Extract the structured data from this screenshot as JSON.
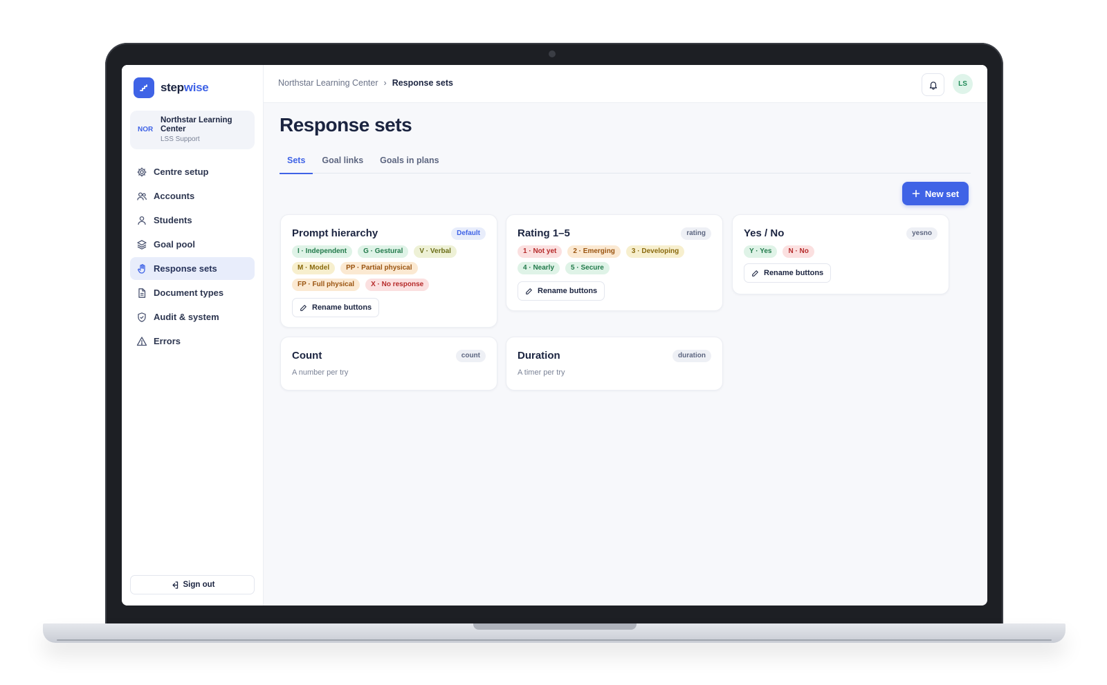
{
  "brand": {
    "name_prefix": "step",
    "name_suffix": "wise"
  },
  "org": {
    "abbr": "NOR",
    "name": "Northstar Learning Center",
    "sub": "LSS Support"
  },
  "nav": [
    {
      "label": "Centre setup",
      "icon": "gear-icon"
    },
    {
      "label": "Accounts",
      "icon": "users-icon"
    },
    {
      "label": "Students",
      "icon": "user-icon"
    },
    {
      "label": "Goal pool",
      "icon": "layers-icon"
    },
    {
      "label": "Response sets",
      "icon": "hand-icon",
      "active": true
    },
    {
      "label": "Document types",
      "icon": "document-icon"
    },
    {
      "label": "Audit & system",
      "icon": "shield-icon"
    },
    {
      "label": "Errors",
      "icon": "warning-icon"
    }
  ],
  "signout": {
    "label": "Sign out"
  },
  "topbar": {
    "breadcrumb": [
      "Northstar Learning Center",
      "Response sets"
    ],
    "separator": "›",
    "avatar": "LS"
  },
  "page": {
    "title": "Response sets",
    "tabs": [
      "Sets",
      "Goal links",
      "Goals in plans"
    ],
    "new_set": "New set"
  },
  "cards": {
    "prompt": {
      "title": "Prompt hierarchy",
      "badge": "Default",
      "chips": [
        "I · Independent",
        "G · Gestural",
        "V · Verbal",
        "M · Model",
        "PP · Partial physical",
        "FP · Full physical",
        "X · No response"
      ],
      "action": "Rename buttons"
    },
    "rating": {
      "title": "Rating 1–5",
      "badge": "rating",
      "chips": [
        "1 · Not yet",
        "2 · Emerging",
        "3 · Developing",
        "4 · Nearly",
        "5 · Secure"
      ],
      "action": "Rename buttons"
    },
    "yesno": {
      "title": "Yes / No",
      "badge": "yesno",
      "chips": [
        "Y · Yes",
        "N · No"
      ],
      "action": "Rename buttons"
    },
    "count": {
      "title": "Count",
      "badge": "count",
      "description": "A number per try"
    },
    "duration": {
      "title": "Duration",
      "badge": "duration",
      "description": "A timer per try"
    }
  },
  "colors": {
    "accent": "#3f63e6",
    "sidebar_active": "#e8edfb",
    "text": "#1b2440"
  }
}
